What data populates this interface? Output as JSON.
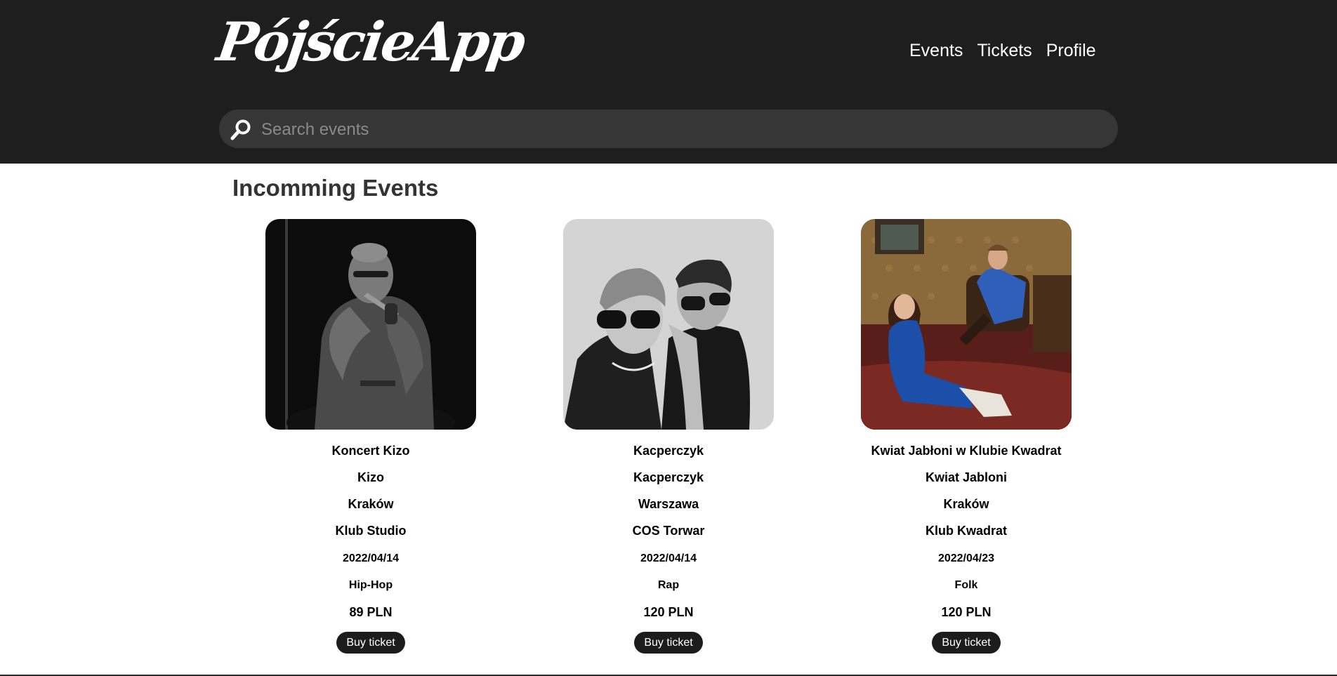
{
  "header": {
    "logo": "PójścieApp",
    "nav": [
      "Events",
      "Tickets",
      "Profile"
    ]
  },
  "search": {
    "placeholder": "Search events",
    "icon": "search-icon"
  },
  "main": {
    "title": "Incomming Events",
    "events": [
      {
        "title": "Koncert Kizo",
        "artist": "Kizo",
        "city": "Kraków",
        "venue": "Klub Studio",
        "date": "2022/04/14",
        "genre": "Hip-Hop",
        "price": "89 PLN",
        "button": "Buy ticket"
      },
      {
        "title": "Kacperczyk",
        "artist": "Kacperczyk",
        "city": "Warszawa",
        "venue": "COS Torwar",
        "date": "2022/04/14",
        "genre": "Rap",
        "price": "120 PLN",
        "button": "Buy ticket"
      },
      {
        "title": "Kwiat Jabłoni w Klubie Kwadrat",
        "artist": "Kwiat Jabloni",
        "city": "Kraków",
        "venue": "Klub Kwadrat",
        "date": "2022/04/23",
        "genre": "Folk",
        "price": "120 PLN",
        "button": "Buy ticket"
      }
    ]
  },
  "colors": {
    "header_bg": "#1e1e1e",
    "search_bg": "#363636",
    "button_bg": "#1c1c1c"
  }
}
